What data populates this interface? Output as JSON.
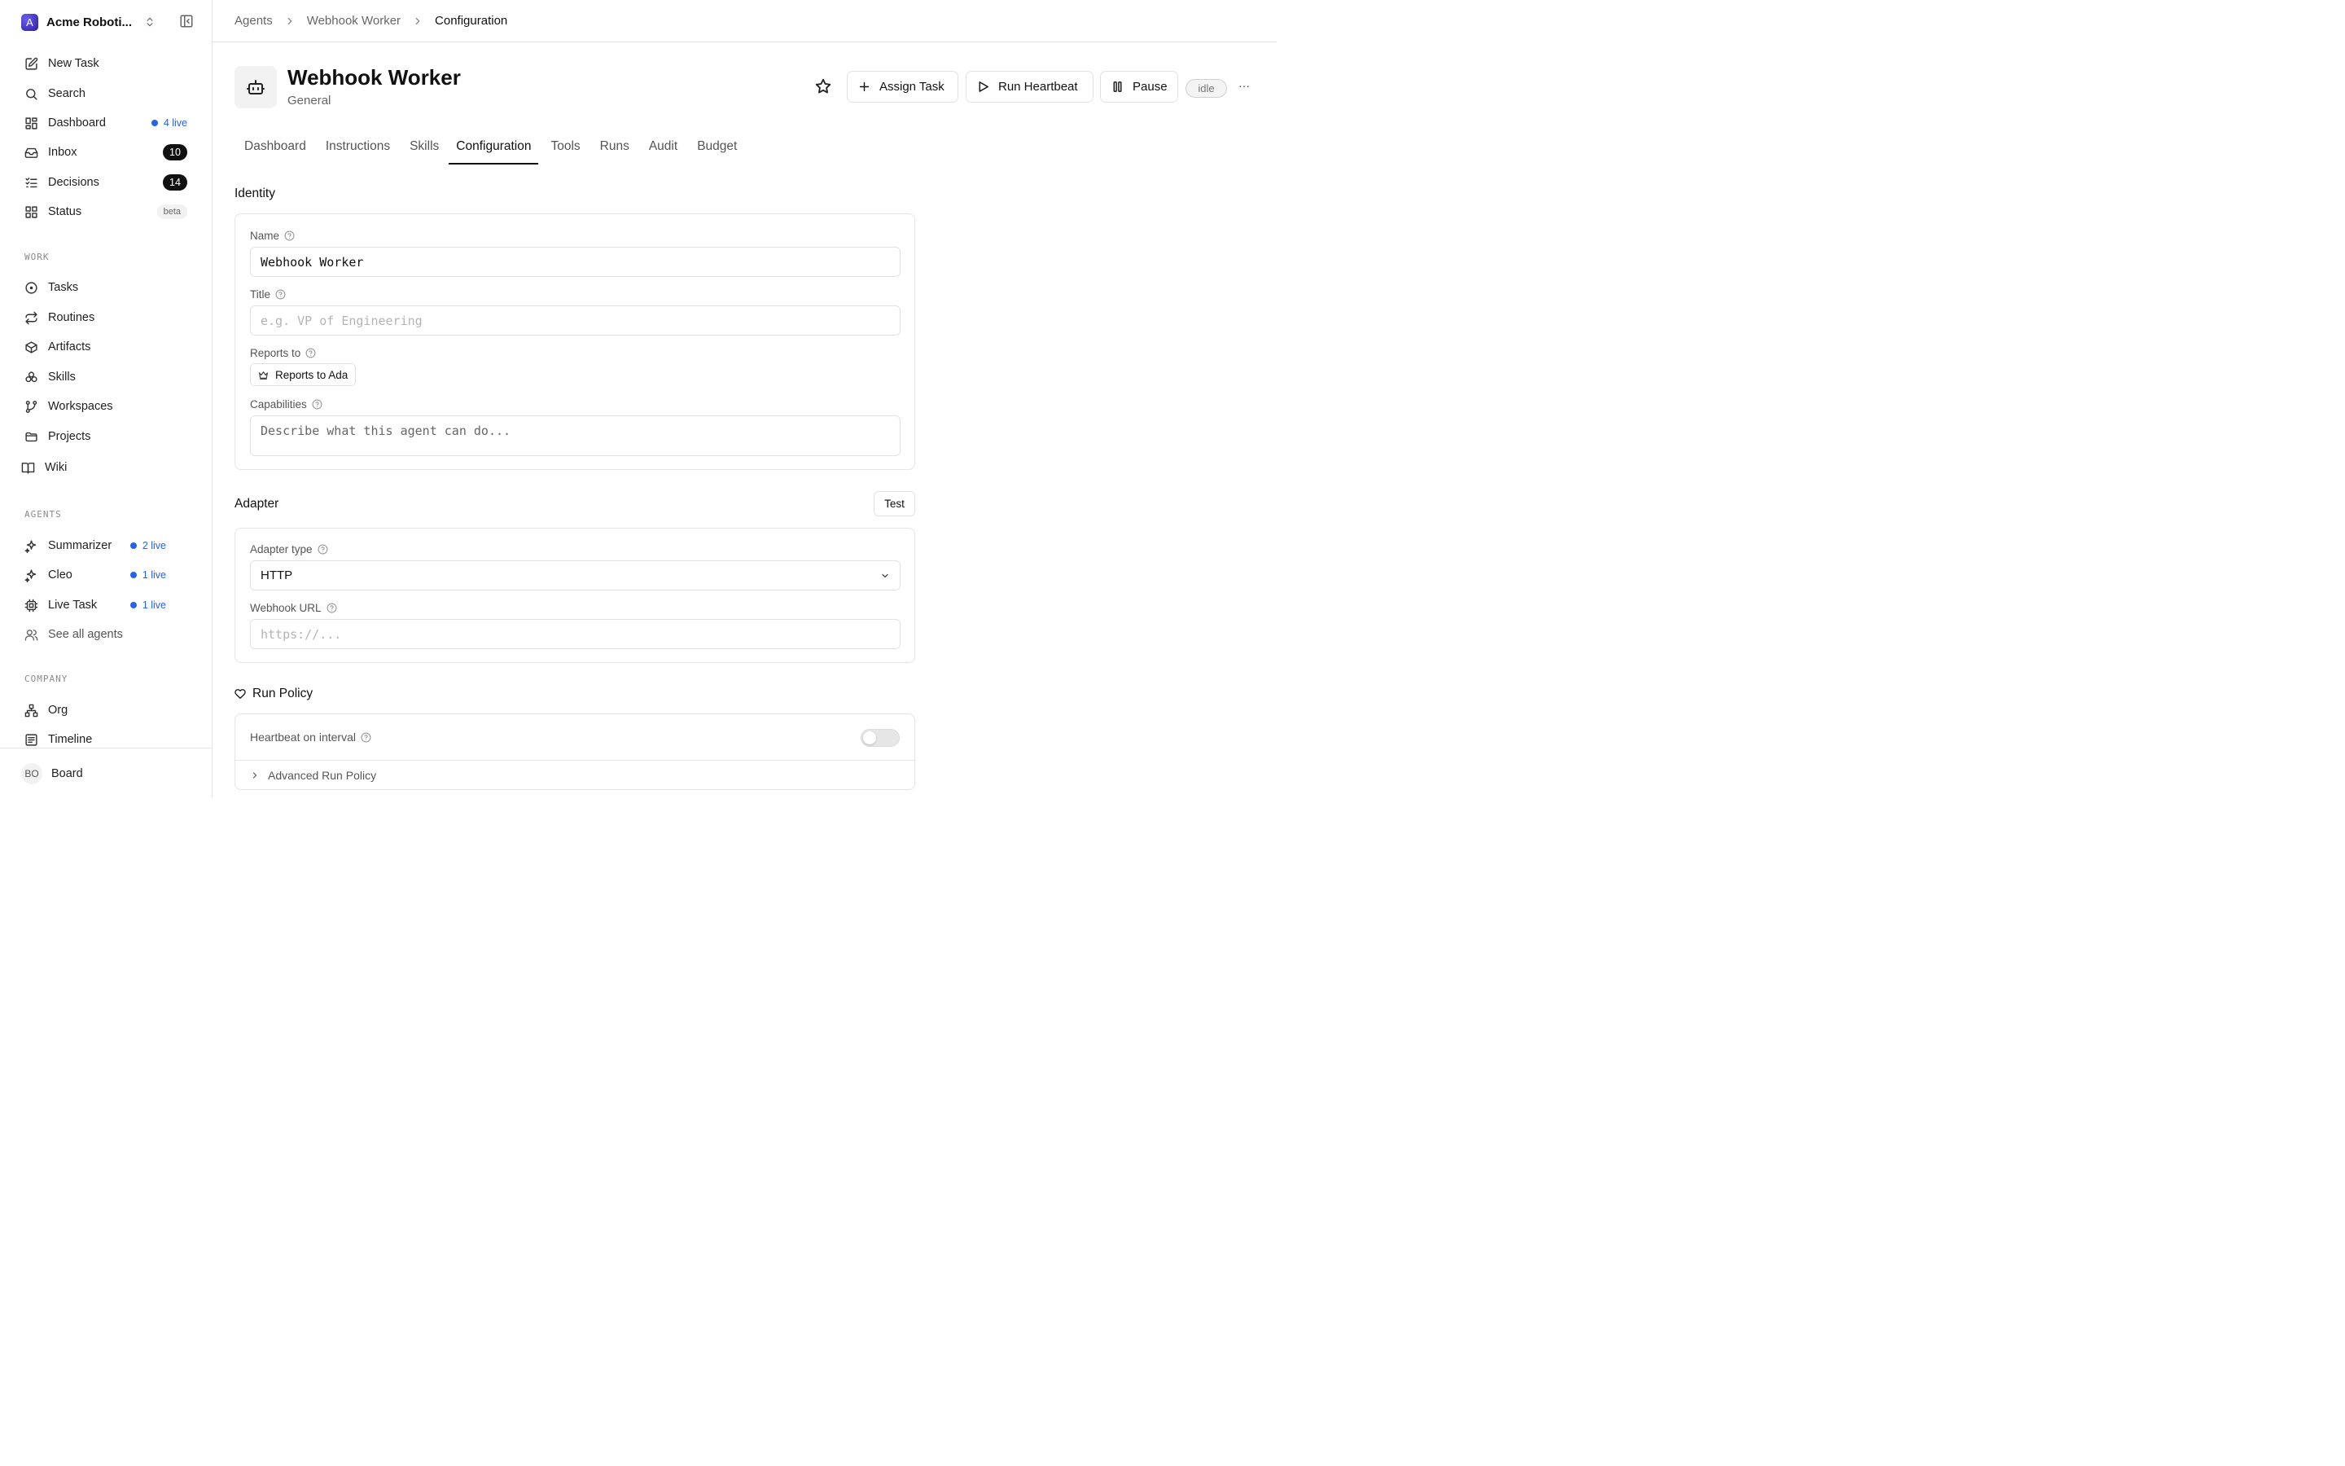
{
  "company": {
    "logo_letter": "A",
    "name": "Acme Roboti..."
  },
  "sidebar": {
    "top_items": [
      {
        "label": "New Task",
        "icon": "edit-icon"
      },
      {
        "label": "Search",
        "icon": "search-icon"
      },
      {
        "label": "Dashboard",
        "icon": "grid-icon",
        "live": "4 live"
      },
      {
        "label": "Inbox",
        "icon": "inbox-icon",
        "count": "10"
      },
      {
        "label": "Decisions",
        "icon": "list-check-icon",
        "count": "14"
      },
      {
        "label": "Status",
        "icon": "grid-icon",
        "badge": "beta"
      }
    ],
    "work_label": "WORK",
    "work_items": [
      {
        "label": "Tasks",
        "icon": "circle-dot-icon"
      },
      {
        "label": "Routines",
        "icon": "repeat-icon"
      },
      {
        "label": "Artifacts",
        "icon": "box-icon"
      },
      {
        "label": "Skills",
        "icon": "boxes-icon"
      },
      {
        "label": "Workspaces",
        "icon": "git-branch-icon"
      },
      {
        "label": "Projects",
        "icon": "folder-icon"
      },
      {
        "label": "Wiki",
        "icon": "book-icon"
      }
    ],
    "agents_label": "AGENTS",
    "agent_items": [
      {
        "label": "Summarizer",
        "icon": "sparkles-icon",
        "live": "2 live"
      },
      {
        "label": "Cleo",
        "icon": "sparkles-icon",
        "live": "1 live"
      },
      {
        "label": "Live Task",
        "icon": "cpu-icon",
        "live": "1 live"
      },
      {
        "label": "See all agents",
        "icon": "users-icon"
      }
    ],
    "company_label": "COMPANY",
    "company_items": [
      {
        "label": "Org",
        "icon": "org-icon"
      },
      {
        "label": "Timeline",
        "icon": "timeline-icon"
      }
    ],
    "footer": {
      "initials": "BO",
      "name": "Board"
    }
  },
  "breadcrumb": [
    "Agents",
    "Webhook Worker",
    "Configuration"
  ],
  "agent": {
    "name": "Webhook Worker",
    "role": "General",
    "status": "idle"
  },
  "actions": {
    "assign": "Assign Task",
    "heartbeat": "Run Heartbeat",
    "pause": "Pause",
    "more": "···"
  },
  "tabs": [
    "Dashboard",
    "Instructions",
    "Skills",
    "Configuration",
    "Tools",
    "Runs",
    "Audit",
    "Budget"
  ],
  "active_tab": "Configuration",
  "identity": {
    "title": "Identity",
    "name_label": "Name",
    "name_value": "Webhook Worker",
    "title_label": "Title",
    "title_placeholder": "e.g. VP of Engineering",
    "reports_label": "Reports to",
    "reports_value": "Reports to Ada",
    "capabilities_label": "Capabilities",
    "capabilities_placeholder": "Describe what this agent can do..."
  },
  "adapter": {
    "title": "Adapter",
    "test_label": "Test",
    "type_label": "Adapter type",
    "type_value": "HTTP",
    "url_label": "Webhook URL",
    "url_placeholder": "https://..."
  },
  "run_policy": {
    "title": "Run Policy",
    "heartbeat_label": "Heartbeat on interval",
    "heartbeat_enabled": false,
    "advanced_label": "Advanced Run Policy"
  },
  "colors": {
    "live": "#2563eb",
    "badge_bg": "#111111",
    "border": "#e5e5e5"
  }
}
